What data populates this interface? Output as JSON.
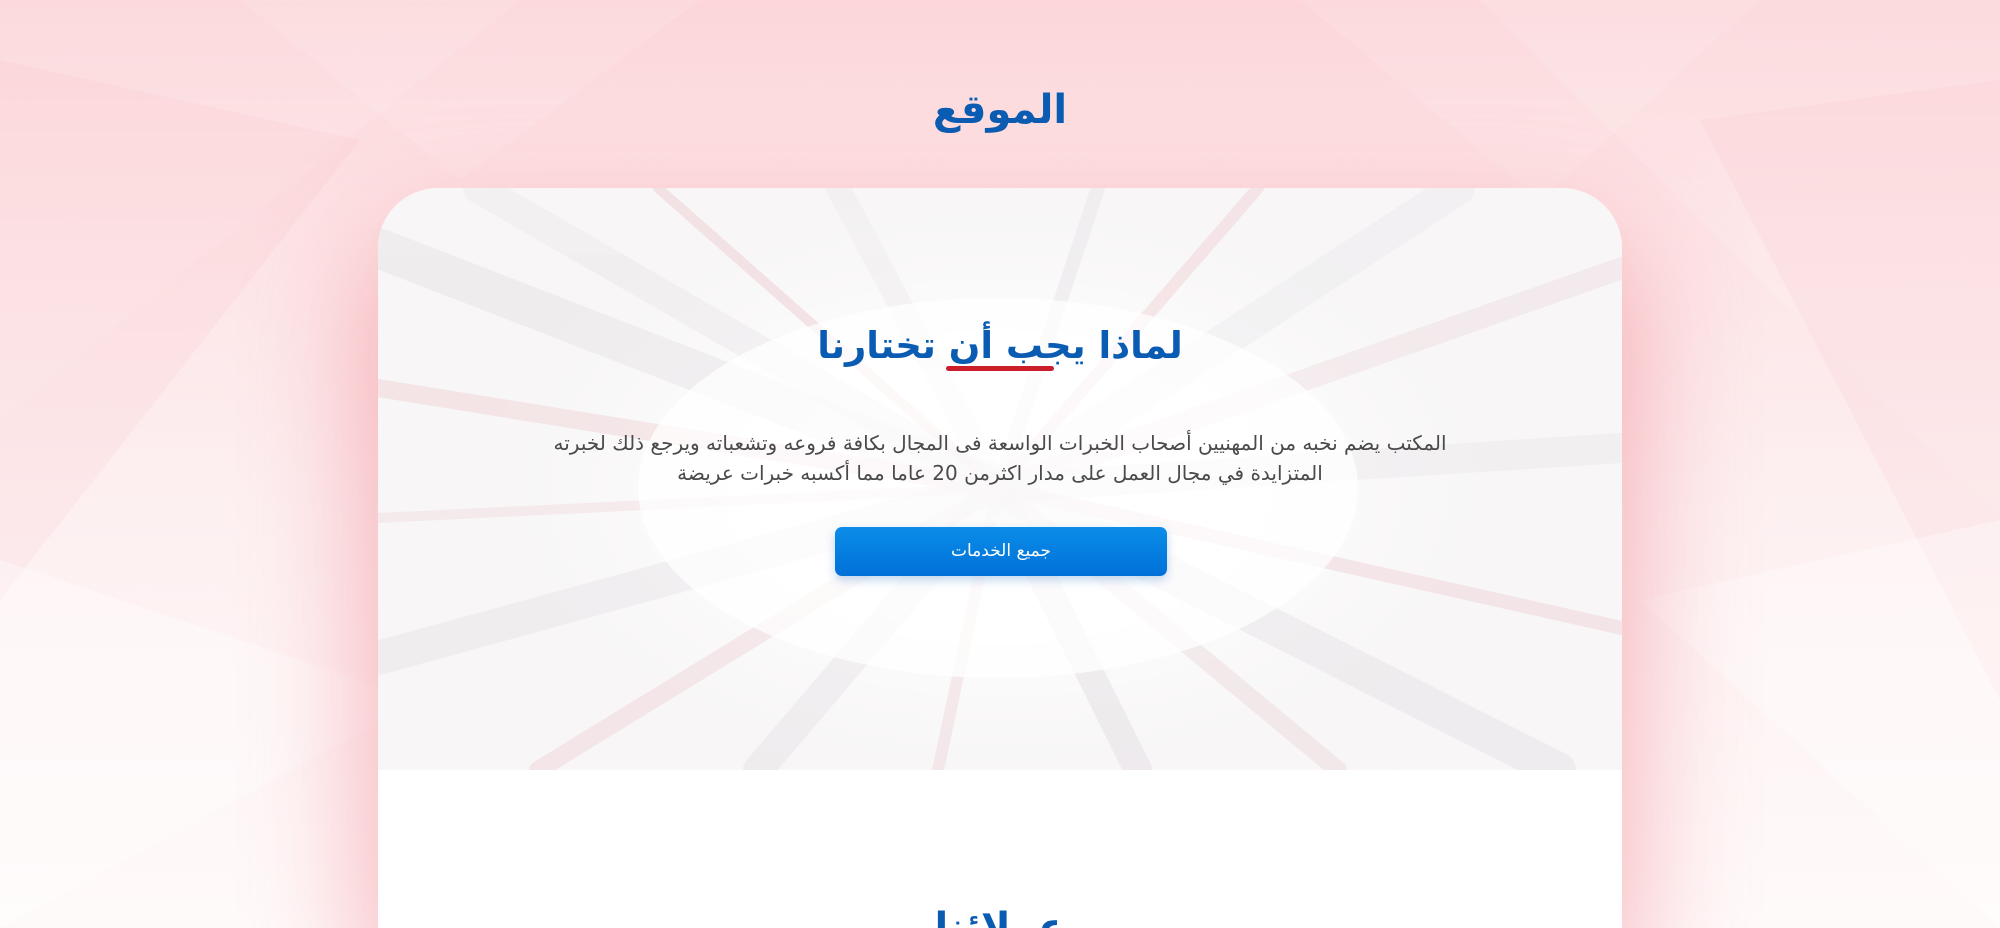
{
  "site": {
    "title": "الموقع"
  },
  "why_us": {
    "title": "لماذا يجب أن تختارنا",
    "description": "المكتب يضم نخبه من المهنيين أصحاب الخبرات الواسعة فى المجال بكافة فروعه وتشعباته ويرجع ذلك لخبرته المتزايدة في مجال العمل على مدار اكثرمن 20 عاما مما أكسبه خبرات عريضة",
    "button_label": "جميع الخدمات"
  },
  "partners": {
    "title": "عملائنا"
  },
  "colors": {
    "primary_blue": "#0a5cb3",
    "button_blue": "#0078dc",
    "accent_red": "#cc1d2b",
    "background_pink": "#fcd6d9",
    "text_gray": "#4a4a4a"
  }
}
